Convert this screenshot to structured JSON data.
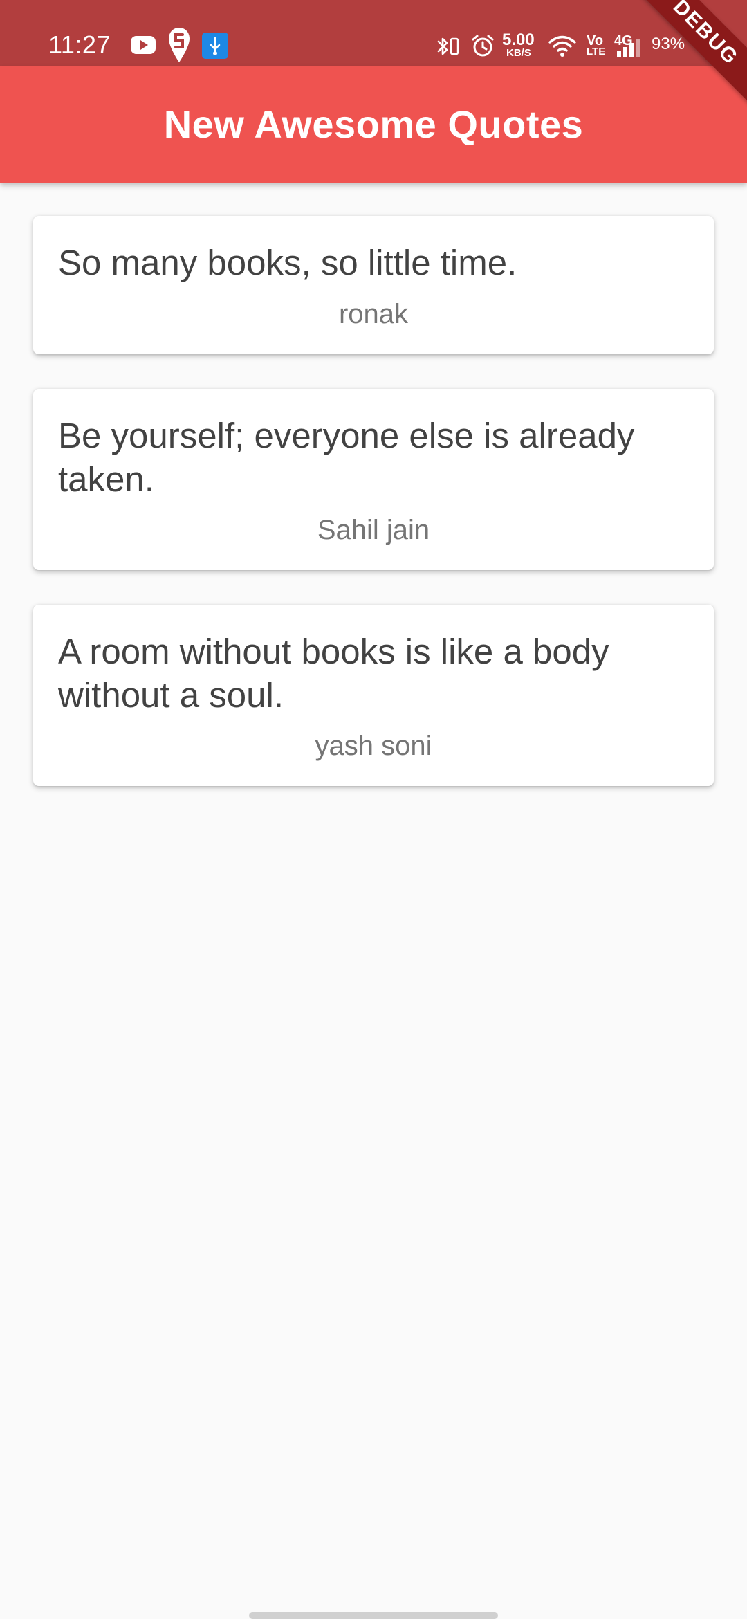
{
  "status_bar": {
    "time": "11:27",
    "network_speed_value": "5.00",
    "network_speed_unit": "KB/S",
    "volte_top": "Vo",
    "volte_bottom": "LTE",
    "network_type": "4G",
    "battery": "93%",
    "bg_color": "#b23e3e"
  },
  "app_bar": {
    "title": "New Awesome Quotes",
    "color": "#ef5350"
  },
  "debug_banner": {
    "label": "DEBUG"
  },
  "quotes": [
    {
      "text": "So many books, so little time.",
      "author": "ronak"
    },
    {
      "text": "Be yourself; everyone else is already taken.",
      "author": "Sahil jain"
    },
    {
      "text": "A room without books is like a body without a soul.",
      "author": "yash soni"
    }
  ],
  "icons": {
    "youtube": "youtube-icon",
    "swiggy": "swiggy-icon",
    "usb": "usb-icon",
    "bluetooth": "bluetooth-vibrate-icon",
    "alarm": "alarm-icon",
    "wifi": "wifi-icon",
    "signal": "signal-icon"
  }
}
